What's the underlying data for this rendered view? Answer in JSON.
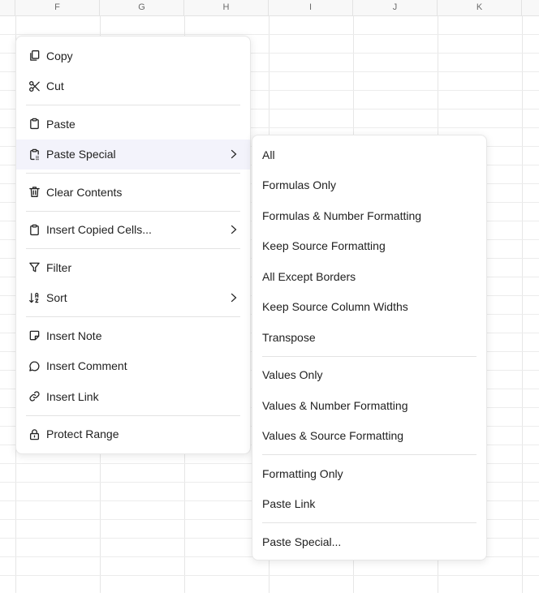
{
  "sheet": {
    "columns": [
      "F",
      "G",
      "H",
      "I",
      "J",
      "K"
    ]
  },
  "context_menu": {
    "copy": "Copy",
    "cut": "Cut",
    "paste": "Paste",
    "paste_special": "Paste Special",
    "clear_contents": "Clear Contents",
    "insert_copied_cells": "Insert Copied Cells...",
    "filter": "Filter",
    "sort": "Sort",
    "insert_note": "Insert Note",
    "insert_comment": "Insert Comment",
    "insert_link": "Insert Link",
    "protect_range": "Protect Range"
  },
  "submenu": {
    "all": "All",
    "formulas_only": "Formulas Only",
    "formulas_number_formatting": "Formulas & Number Formatting",
    "keep_source_formatting": "Keep Source Formatting",
    "all_except_borders": "All Except Borders",
    "keep_source_column_widths": "Keep Source Column Widths",
    "transpose": "Transpose",
    "values_only": "Values Only",
    "values_number_formatting": "Values & Number Formatting",
    "values_source_formatting": "Values & Source Formatting",
    "formatting_only": "Formatting Only",
    "paste_link": "Paste Link",
    "paste_special_dialog": "Paste Special..."
  },
  "colors": {
    "active_item_bg": "#f3f3fb",
    "grid_line": "#e6e6e6",
    "header_bg": "#f8f8f8"
  }
}
